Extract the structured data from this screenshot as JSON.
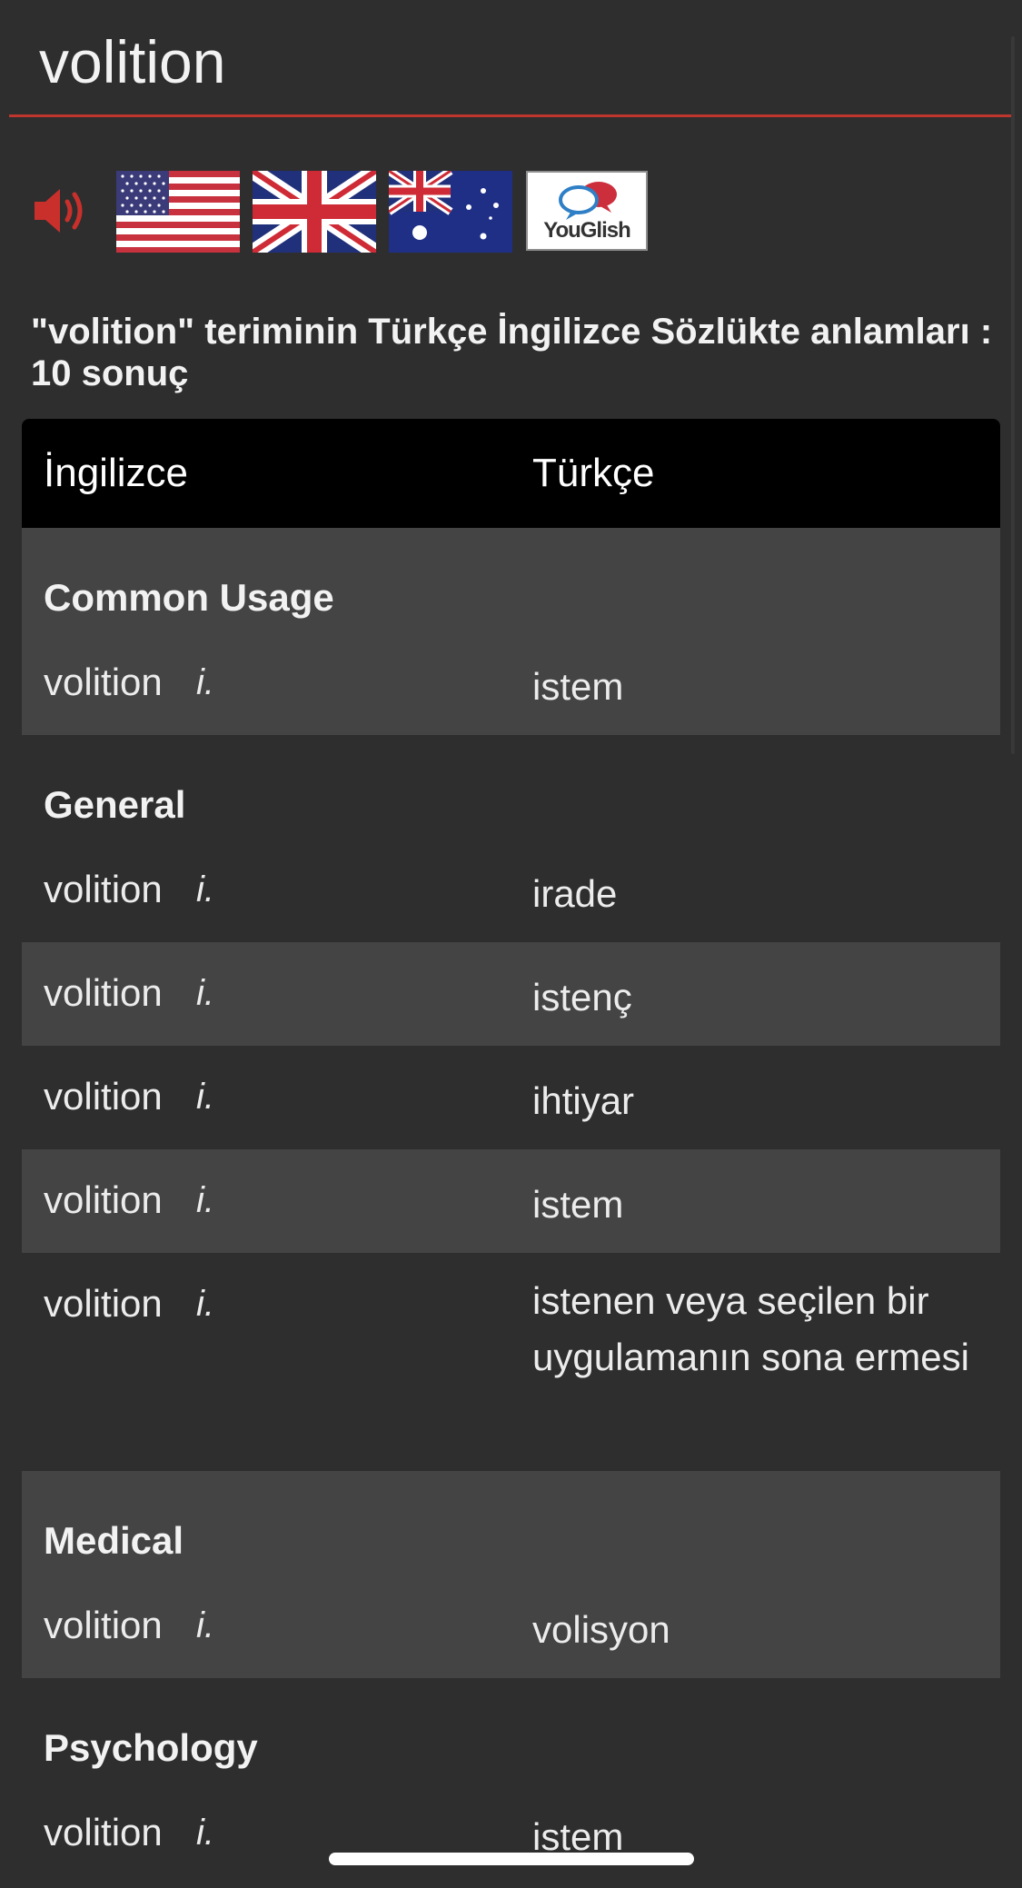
{
  "search": {
    "value": "volition"
  },
  "icons": {
    "speaker": "speaker-icon",
    "flags": [
      "us-flag-icon",
      "uk-flag-icon",
      "australia-flag-icon"
    ],
    "youglish_label": "YouGlish"
  },
  "result_heading": "\"volition\" teriminin Türkçe İngilizce Sözlükte anlamları : 10 sonuç",
  "table": {
    "headers": {
      "col1": "İngilizce",
      "col2": "Türkçe"
    },
    "groups": [
      {
        "category": "Common Usage",
        "entries": [
          {
            "en": "volition",
            "pos": "i.",
            "tr": "istem"
          }
        ]
      },
      {
        "category": "General",
        "entries": [
          {
            "en": "volition",
            "pos": "i.",
            "tr": "irade"
          },
          {
            "en": "volition",
            "pos": "i.",
            "tr": "istenç"
          },
          {
            "en": "volition",
            "pos": "i.",
            "tr": "ihtiyar"
          },
          {
            "en": "volition",
            "pos": "i.",
            "tr": "istem"
          },
          {
            "en": "volition",
            "pos": "i.",
            "tr": "istenen veya seçilen bir uygulamanın sona ermesi"
          }
        ]
      },
      {
        "category": "Medical",
        "entries": [
          {
            "en": "volition",
            "pos": "i.",
            "tr": "volisyon"
          }
        ]
      },
      {
        "category": "Psychology",
        "entries": [
          {
            "en": "volition",
            "pos": "i.",
            "tr": "istem"
          }
        ]
      }
    ]
  },
  "colors": {
    "accent": "#c0352d",
    "background": "#2e2e2e",
    "row_alt": "#444444",
    "header_bg": "#000000"
  }
}
